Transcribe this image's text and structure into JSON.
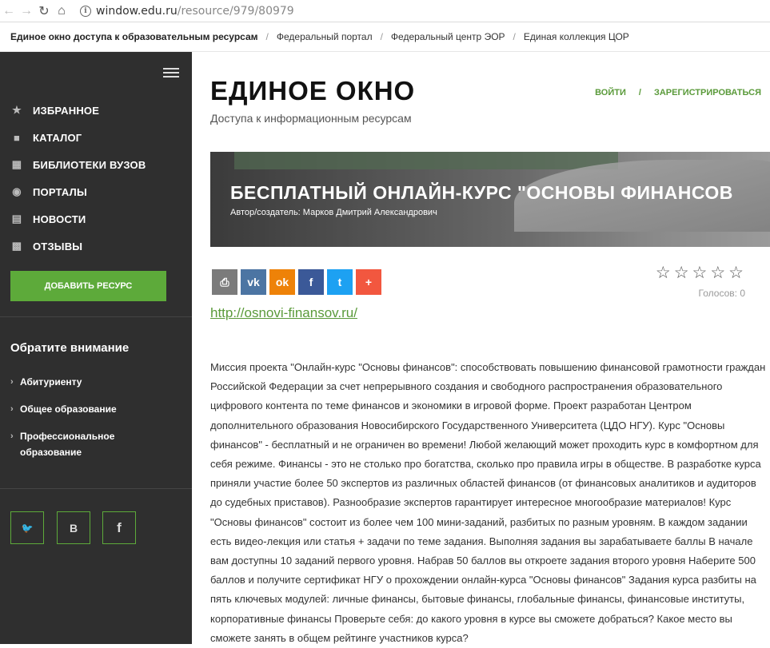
{
  "browser": {
    "url_host": "window.edu.ru",
    "url_path": "/resource/979/80979"
  },
  "topbar": {
    "brand": "Единое окно доступа к образовательным ресурсам",
    "links": [
      "Федеральный портал",
      "Федеральный центр ЭОР",
      "Единая коллекция ЦОР"
    ]
  },
  "sidebar": {
    "menu": [
      {
        "label": "ИЗБРАННОЕ",
        "icon": "star-icon"
      },
      {
        "label": "КАТАЛОГ",
        "icon": "catalog-icon"
      },
      {
        "label": "БИБЛИОТЕКИ ВУЗОВ",
        "icon": "library-icon"
      },
      {
        "label": "ПОРТАЛЫ",
        "icon": "portals-icon"
      },
      {
        "label": "НОВОСТИ",
        "icon": "news-icon"
      },
      {
        "label": "ОТЗЫВЫ",
        "icon": "reviews-icon"
      }
    ],
    "add_button": "ДОБАВИТЬ РЕСУРС",
    "attention_title": "Обратите внимание",
    "attention_items": [
      "Абитуриенту",
      "Общее образование",
      "Профессиональное образование"
    ],
    "social": [
      "twitter-icon",
      "vk-icon",
      "facebook-icon"
    ],
    "social_labels": [
      "🐦",
      "В",
      "f"
    ]
  },
  "header": {
    "title": "ЕДИНОЕ ОКНО",
    "subtitle": "Доступа к информационным ресурсам",
    "login": "ВОЙТИ",
    "register": "ЗАРЕГИСТРИРОВАТЬСЯ"
  },
  "banner": {
    "title": "БЕСПЛАТНЫЙ ОНЛАЙН-КУРС \"ОСНОВЫ ФИНАНСОВ",
    "author": "Автор/создатель: Марков Дмитрий Александрович"
  },
  "share": [
    {
      "name": "print-icon",
      "glyph": "⎙",
      "color": "#7b7b7b"
    },
    {
      "name": "vk-icon",
      "glyph": "vk",
      "color": "#4c75a3"
    },
    {
      "name": "odnoklassniki-icon",
      "glyph": "ok",
      "color": "#ee8208"
    },
    {
      "name": "facebook-icon",
      "glyph": "f",
      "color": "#3b5998"
    },
    {
      "name": "twitter-icon",
      "glyph": "t",
      "color": "#1da1f2"
    },
    {
      "name": "more-icon",
      "glyph": "+",
      "color": "#f2573f"
    }
  ],
  "rating": {
    "stars": 5,
    "votes": "Голосов: 0"
  },
  "link": "http://osnovi-finansov.ru/",
  "description": "Миссия проекта \"Онлайн-курс \"Основы финансов\": способствовать повышению финансовой грамотности граждан Российской Федерации за счет непрерывного создания и свободного распространения образовательного цифрового контента по теме финансов и экономики в игровой форме. Проект разработан Центром дополнительного образования Новосибирского Государственного Университета (ЦДО НГУ). Курс \"Основы финансов\" - бесплатный и не ограничен во времени! Любой желающий может проходить курс в комфортном для себя режиме. Финансы - это не столько про богатства, сколько про правила игры в обществе. В разработке курса приняли участие более 50 экспертов из различных областей финансов (от финансовых аналитиков и аудиторов до судебных приставов). Разнообразие экспертов гарантирует интересное многообразие материалов! Курс \"Основы финансов\" состоит из более чем 100 мини-заданий, разбитых по разным уровням. В каждом задании есть видео-лекция или статья + задачи по теме задания. Выполняя задания вы зарабатываете баллы В начале вам доступны 10 заданий первого уровня. Набрав 50 баллов вы откроете задания второго уровня Наберите 500 баллов и получите сертификат НГУ о прохождении онлайн-курса \"Основы финансов\" Задания курса разбиты на пять ключевых модулей: личные финансы, бытовые финансы, глобальные финансы, финансовые институты, корпоративные финансы Проверьте себя: до какого уровня в курсе вы сможете добраться? Какое место вы сможете занять в общем рейтинге участников курса?"
}
